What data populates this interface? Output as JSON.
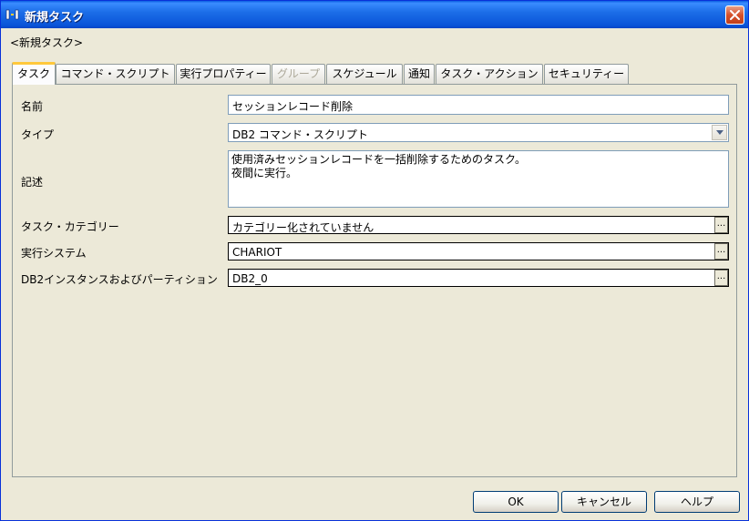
{
  "window": {
    "title": "新規タスク"
  },
  "breadcrumb": "<新規タスク>",
  "tabs": [
    {
      "label": "タスク",
      "state": "active"
    },
    {
      "label": "コマンド・スクリプト",
      "state": "normal"
    },
    {
      "label": "実行プロパティー",
      "state": "normal"
    },
    {
      "label": "グループ",
      "state": "disabled"
    },
    {
      "label": "スケジュール",
      "state": "normal"
    },
    {
      "label": "通知",
      "state": "normal"
    },
    {
      "label": "タスク・アクション",
      "state": "normal"
    },
    {
      "label": "セキュリティー",
      "state": "normal"
    }
  ],
  "form": {
    "name_label": "名前",
    "name_value": "セッションレコード削除",
    "type_label": "タイプ",
    "type_value": "DB2 コマンド・スクリプト",
    "desc_label": "記述",
    "desc_value": "使用済みセッションレコードを一括削除するためのタスク。\n夜間に実行。",
    "category_label": "タスク・カテゴリー",
    "category_value": "カテゴリー化されていません",
    "system_label": "実行システム",
    "system_value": "CHARIOT",
    "instance_label": "DB2インスタンスおよびパーティション",
    "instance_value": "DB2_0",
    "browse_label": "..."
  },
  "buttons": {
    "ok": "OK",
    "cancel": "キャンセル",
    "help": "ヘルプ"
  },
  "colors": {
    "titlebar": "#0a54d8",
    "active_tab_accent": "#ffc83c",
    "face": "#ece9d8",
    "field_border": "#7f9db9"
  }
}
